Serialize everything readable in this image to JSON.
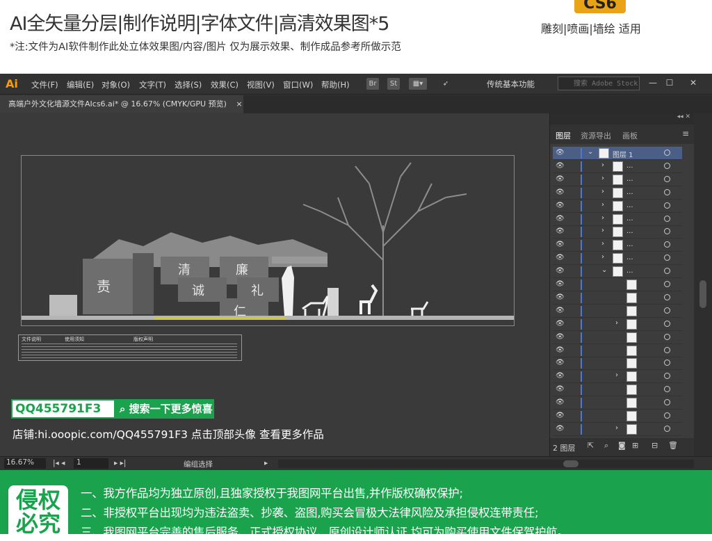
{
  "banner": {
    "title": "AI全矢量分层|制作说明|字体文件|高清效果图*5",
    "note": "*注:文件为AI软件制作此处立体效果图/内容/图片 仅为展示效果、制作成品参考所做示范",
    "badge": "CS6",
    "usage": "雕刻|喷画|墙绘 适用"
  },
  "app": {
    "logo": "Ai",
    "menu": [
      "文件(F)",
      "编辑(E)",
      "对象(O)",
      "文字(T)",
      "选择(S)",
      "效果(C)",
      "视图(V)",
      "窗口(W)",
      "帮助(H)"
    ],
    "toolbar_icons": [
      "Br",
      "St"
    ],
    "workspace": "传统基本功能",
    "stock_search_placeholder": "搜索 Adobe Stock",
    "doc_tab": "高端户外文化墙源文件AIcs6.ai* @ 16.67% (CMYK/GPU 预览)",
    "doc_tab_close": "×"
  },
  "artwork": {
    "chars": [
      "责",
      "清",
      "廉",
      "诚",
      "礼",
      "仁"
    ],
    "info_sections": [
      "文件说明",
      "使用须知",
      "版权声明"
    ]
  },
  "layers_panel": {
    "tabs": [
      "图层",
      "资源导出",
      "画板"
    ],
    "rows": [
      {
        "name": "图层 1",
        "expanded": true,
        "level": 0
      },
      {
        "name": "...",
        "level": 1
      },
      {
        "name": "...",
        "level": 1
      },
      {
        "name": "...",
        "level": 1
      },
      {
        "name": "...",
        "level": 1
      },
      {
        "name": "...",
        "level": 1
      },
      {
        "name": "...",
        "level": 1
      },
      {
        "name": "...",
        "level": 1
      },
      {
        "name": "...",
        "level": 1
      },
      {
        "name": "...",
        "level": 1,
        "expanded": true
      },
      {
        "name": "",
        "level": 2
      },
      {
        "name": "",
        "level": 2
      },
      {
        "name": "",
        "level": 2
      },
      {
        "name": "",
        "level": 2
      },
      {
        "name": "",
        "level": 2
      },
      {
        "name": "",
        "level": 2
      },
      {
        "name": "",
        "level": 2
      },
      {
        "name": "",
        "level": 2
      },
      {
        "name": "",
        "level": 2
      },
      {
        "name": "",
        "level": 2
      },
      {
        "name": "",
        "level": 2
      },
      {
        "name": "",
        "level": 2
      }
    ],
    "layer_count": "2 图层"
  },
  "status": {
    "zoom": "16.67%",
    "artboard": "1",
    "mode": "编组选择"
  },
  "promo": {
    "qq": "QQ455791F3",
    "search_label": "搜索一下更多惊喜",
    "shop": "店铺:hi.ooopic.com/QQ455791F3  点击顶部头像 查看更多作品"
  },
  "footer": {
    "badge": "侵权必究",
    "clauses": [
      "一、我方作品均为独立原创,且独家授权于我图网平台出售,并作版权确权保护;",
      "二、非授权平台出现均为违法盗卖、抄袭、盗图,购买会冒极大法律风险及承担侵权连带责任;",
      "三、我图网平台完善的售后服务、正式授权协议、原创设计师认证,均可为购买使用文件保驾护航。"
    ]
  },
  "colors": {
    "accent": "#1aa24c",
    "badge": "#e8a316",
    "app_bg": "#323232"
  }
}
